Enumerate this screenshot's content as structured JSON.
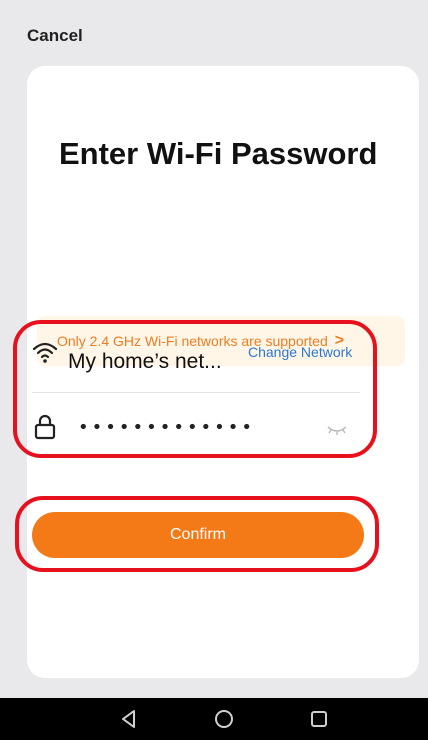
{
  "header": {
    "cancel_label": "Cancel"
  },
  "card": {
    "title": "Enter Wi-Fi Password",
    "notice": {
      "text": "Only 2.4 GHz Wi-Fi networks are supported",
      "chevron": ">"
    },
    "network": {
      "name": "My home’s net...",
      "change_label": "Change Network"
    },
    "password": {
      "value": "•••••••••••••"
    },
    "confirm_label": "Confirm"
  },
  "colors": {
    "accent": "#f47a18",
    "notice_bg": "#fff6e8",
    "notice_text": "#ef7d22",
    "link": "#2b78d3",
    "highlight_ring": "#e8101c"
  },
  "icons": {
    "wifi": "wifi-icon",
    "lock": "lock-icon",
    "password_visibility": "eye-closed-icon",
    "nav_back": "back-triangle-icon",
    "nav_home": "home-circle-icon",
    "nav_recents": "recents-square-icon"
  }
}
